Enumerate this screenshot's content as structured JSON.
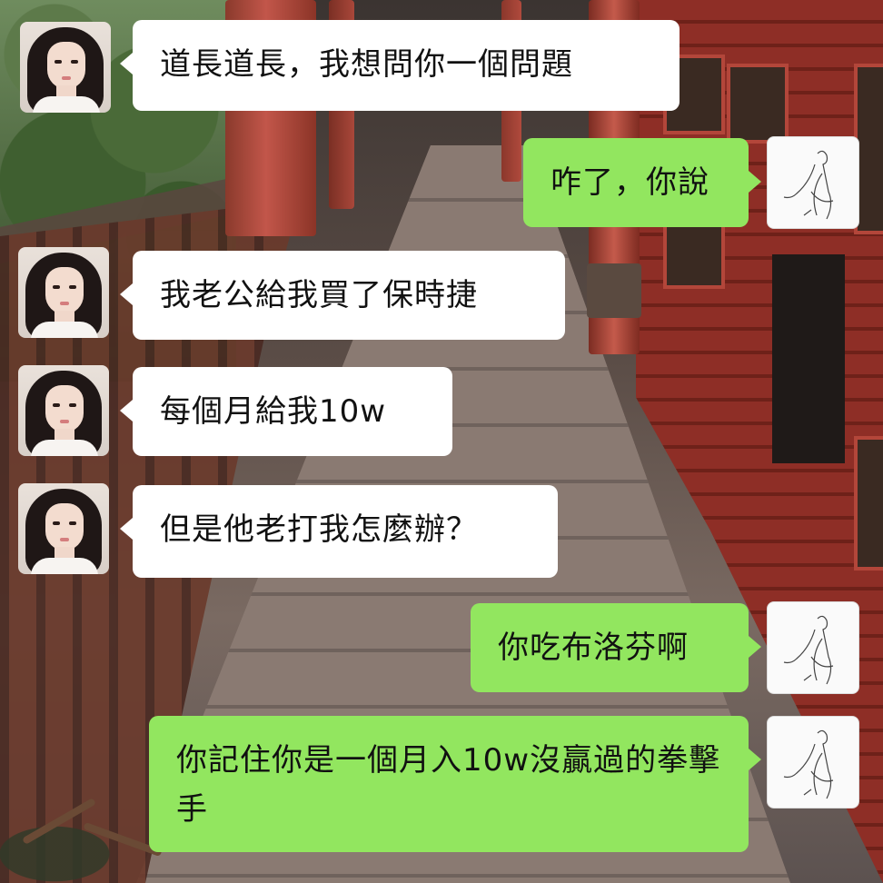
{
  "colors": {
    "incoming_bubble": "#ffffff",
    "outgoing_bubble": "#92e65f",
    "text": "#111111"
  },
  "contact_avatar": "woman-portrait-avatar",
  "self_avatar": "sketch-figure-avatar",
  "messages": [
    {
      "side": "left",
      "text": "道長道長，我想問你一個問題"
    },
    {
      "side": "right",
      "text": "咋了，你說"
    },
    {
      "side": "left",
      "text": "我老公給我買了保時捷"
    },
    {
      "side": "left",
      "text": "每個月給我10w"
    },
    {
      "side": "left",
      "text": "但是他老打我怎麼辦？"
    },
    {
      "side": "right",
      "text": "你吃布洛芬啊"
    },
    {
      "side": "right",
      "text": "你記住你是一個月入10w沒贏過的拳擊手"
    }
  ]
}
